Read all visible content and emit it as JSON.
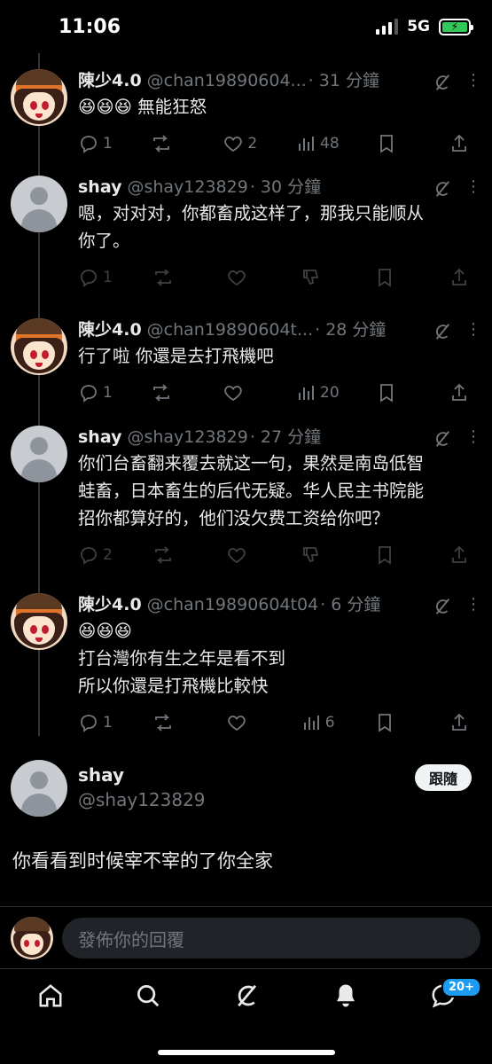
{
  "status_bar": {
    "time": "11:06",
    "network": "5G",
    "battery_icon": "battery-charging-icon"
  },
  "thread": [
    {
      "name": "陳少4.0",
      "handle": "@chan19890604...",
      "time": "· 31 分鐘",
      "text_lines": [
        "😆😆😆 無能狂怒"
      ],
      "avatar": "anime",
      "stats": {
        "reply": "1",
        "repost": "",
        "like": "2",
        "views": "48"
      },
      "dim": false,
      "liked_icon": "heart-icon"
    },
    {
      "name": "shay",
      "handle": "@shay123829",
      "time": "· 30 分鐘",
      "text_lines": [
        "嗯，对对对，你都畜成这样了，那我只能顺从",
        "你了。"
      ],
      "avatar": "default",
      "stats": {
        "reply": "1",
        "repost": "",
        "like": "",
        "views": ""
      },
      "dim": true
    },
    {
      "name": "陳少4.0",
      "handle": "@chan19890604t...",
      "time": "· 28 分鐘",
      "text_lines": [
        "行了啦 你還是去打飛機吧"
      ],
      "avatar": "anime",
      "stats": {
        "reply": "1",
        "repost": "",
        "like": "",
        "views": "20"
      },
      "dim": false
    },
    {
      "name": "shay",
      "handle": "@shay123829",
      "time": "· 27 分鐘",
      "text_lines": [
        "你们台畜翻来覆去就这一句，果然是南岛低智",
        "蛙畜，日本畜生的后代无疑。华人民主书院能",
        "招你都算好的，他们没欠费工资给你吧？"
      ],
      "avatar": "default",
      "stats": {
        "reply": "2",
        "repost": "",
        "like": "",
        "views": ""
      },
      "dim": true
    },
    {
      "name": "陳少4.0",
      "handle": "@chan19890604t04",
      "time": "· 6 分鐘",
      "text_lines": [
        "😆😆😆",
        "打台灣你有生之年是看不到",
        "所以你還是打飛機比較快"
      ],
      "avatar": "anime",
      "stats": {
        "reply": "1",
        "repost": "",
        "like": "",
        "views": "6"
      },
      "dim": false
    }
  ],
  "main_tweet": {
    "name": "shay",
    "handle": "@shay123829",
    "follow_label": "跟隨",
    "text": "你看看到时候宰不宰的了你全家"
  },
  "reply_bar": {
    "placeholder": "發佈你的回覆"
  },
  "nav": {
    "notifications_badge": "20+"
  },
  "colors": {
    "background": "#000000",
    "text": "#e7e9ea",
    "muted": "#71767b",
    "accent": "#1d9bf0"
  }
}
